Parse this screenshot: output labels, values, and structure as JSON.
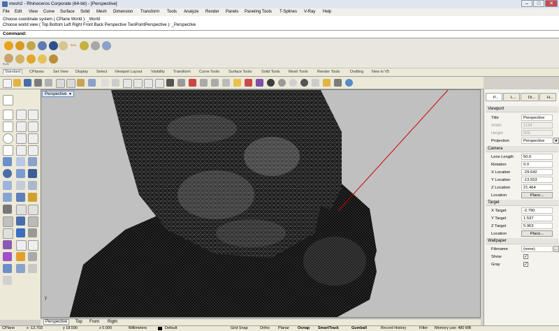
{
  "window": {
    "title": "mesh2 - Rhinoceros Corporate (64-bit) - [Perspective]",
    "minimize": "–",
    "maximize": "□",
    "close": "✕"
  },
  "menu": [
    "File",
    "Edit",
    "View",
    "Curve",
    "Surface",
    "Solid",
    "Mesh",
    "Dimension",
    "Transform",
    "Tools",
    "Analyze",
    "Render",
    "Panels",
    "Paneling Tools",
    "T-Splines",
    "V-Ray",
    "Help"
  ],
  "command_history": [
    "Choose coordinate system ( CPlane  World ): _World",
    "Choose world view ( Top  Bottom  Left  Right  Front  Back  Perspective  TwoPointPerspective ): _Perspective"
  ],
  "command_prompt": "Command:",
  "plugin_labels": {
    "sun": "SUN",
    "run": "RUN"
  },
  "toolbar_tabs": [
    "Standard",
    "CPlanes",
    "Set View",
    "Display",
    "Select",
    "Viewport Layout",
    "Visibility",
    "Transform",
    "Curve Tools",
    "Surface Tools",
    "Solid Tools",
    "Mesh Tools",
    "Render Tools",
    "Drafting",
    "New in V5"
  ],
  "active_toolbar_tab": "Standard",
  "viewport": {
    "title": "Perspective",
    "axis_label": "y"
  },
  "viewport_tabs": [
    "Perspective",
    "Top",
    "Front",
    "Right"
  ],
  "active_viewport_tab": "Perspective",
  "status": {
    "cplane": "CPlane",
    "x": "x -13.703",
    "y": "y 18.590",
    "z": "z 0.000",
    "units": "Millimeters",
    "layer": "Default",
    "toggles": [
      "Grid Snap",
      "Ortho",
      "Planar",
      "Osnap",
      "SmartTrack",
      "Gumball",
      "Record History",
      "Filter"
    ],
    "memory": "Memory use: 480 MB"
  },
  "panel": {
    "tabs": [
      "P...",
      "L...",
      "Di...",
      "H..."
    ],
    "sections": {
      "viewport": {
        "header": "Viewport",
        "rows": [
          {
            "label": "Title",
            "value": "Perspective"
          },
          {
            "label": "Width",
            "value": "1134"
          },
          {
            "label": "Height",
            "value": "502"
          },
          {
            "label": "Projection",
            "value": "Perspective"
          }
        ]
      },
      "camera": {
        "header": "Camera",
        "rows": [
          {
            "label": "Lens Length",
            "value": "50.0"
          },
          {
            "label": "Rotation",
            "value": "0.0"
          },
          {
            "label": "X Location",
            "value": "-29.642"
          },
          {
            "label": "Y Location",
            "value": "-13.553"
          },
          {
            "label": "Z Location",
            "value": "21.464"
          },
          {
            "label": "Location",
            "value": "Place..."
          }
        ]
      },
      "target": {
        "header": "Target",
        "rows": [
          {
            "label": "X Target",
            "value": "-2.790"
          },
          {
            "label": "Y Target",
            "value": "1.537"
          },
          {
            "label": "Z Target",
            "value": "5.963"
          },
          {
            "label": "Location",
            "value": "Place..."
          }
        ]
      },
      "wallpaper": {
        "header": "Wallpaper",
        "rows": [
          {
            "label": "Filename",
            "value": "(none)"
          },
          {
            "label": "Show",
            "value": "✓"
          },
          {
            "label": "Gray",
            "value": "✓"
          }
        ]
      }
    },
    "more_button": "..."
  },
  "colors": {
    "accent_red": "#cc0000",
    "mesh_dark": "#111111",
    "viewport_bg": "#c0c0c0"
  }
}
